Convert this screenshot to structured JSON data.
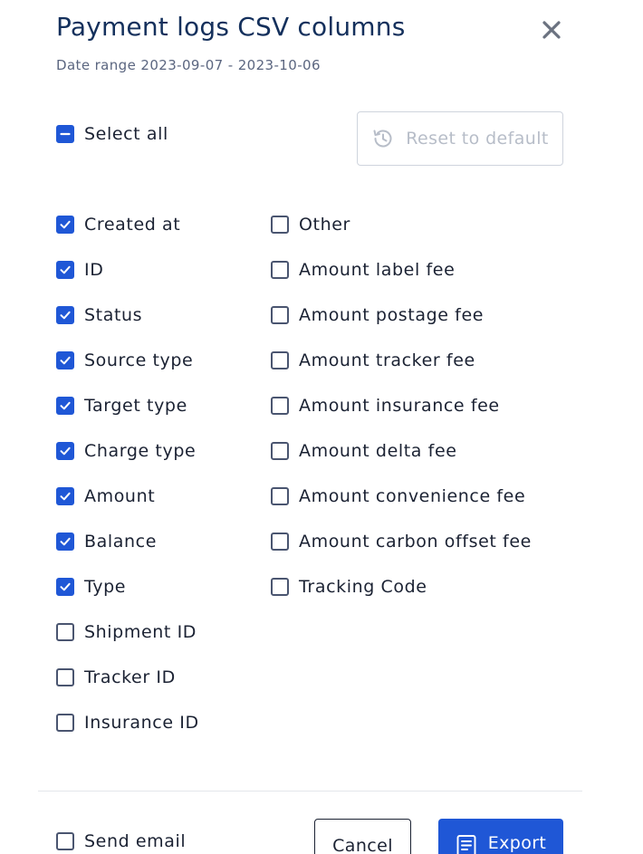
{
  "dialog": {
    "title": "Payment logs CSV columns",
    "date_range": "Date range 2023-09-07 - 2023-10-06",
    "close_icon": "close-icon"
  },
  "select_all": {
    "label": "Select all",
    "state": "indeterminate"
  },
  "reset_button": {
    "label": "Reset to default",
    "icon": "history-icon",
    "disabled": true
  },
  "columns_left": [
    {
      "label": "Created at",
      "checked": true
    },
    {
      "label": "ID",
      "checked": true
    },
    {
      "label": "Status",
      "checked": true
    },
    {
      "label": "Source type",
      "checked": true
    },
    {
      "label": "Target type",
      "checked": true
    },
    {
      "label": "Charge type",
      "checked": true
    },
    {
      "label": "Amount",
      "checked": true
    },
    {
      "label": "Balance",
      "checked": true
    },
    {
      "label": "Type",
      "checked": true
    },
    {
      "label": "Shipment ID",
      "checked": false
    },
    {
      "label": "Tracker ID",
      "checked": false
    },
    {
      "label": "Insurance ID",
      "checked": false
    }
  ],
  "columns_right": [
    {
      "label": "Other",
      "checked": false
    },
    {
      "label": "Amount label fee",
      "checked": false
    },
    {
      "label": "Amount postage fee",
      "checked": false
    },
    {
      "label": "Amount tracker fee",
      "checked": false
    },
    {
      "label": "Amount insurance fee",
      "checked": false
    },
    {
      "label": "Amount delta fee",
      "checked": false
    },
    {
      "label": "Amount convenience fee",
      "checked": false
    },
    {
      "label": "Amount carbon offset fee",
      "checked": false
    },
    {
      "label": "Tracking Code",
      "checked": false
    }
  ],
  "footer": {
    "send_email_label": "Send email",
    "send_email_checked": false,
    "cancel_label": "Cancel",
    "export_label": "Export",
    "export_icon": "document-icon"
  },
  "colors": {
    "primary": "#1f57d6",
    "title": "#14305c",
    "text": "#1b2233",
    "muted": "#5b6680",
    "disabled": "#b7bdc8"
  }
}
